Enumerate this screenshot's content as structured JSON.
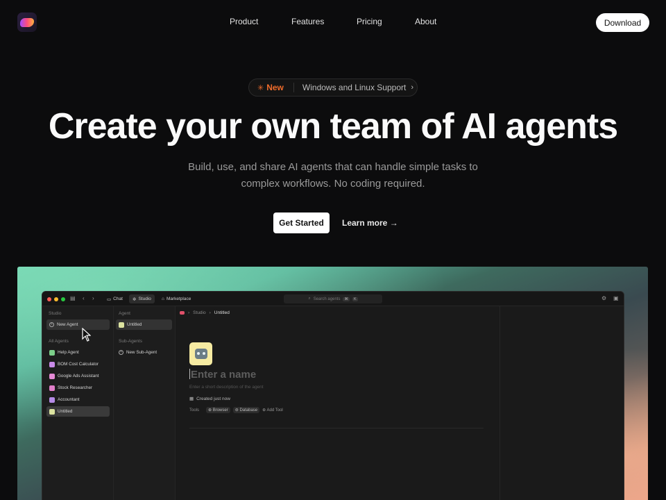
{
  "nav": {
    "links": [
      "Product",
      "Features",
      "Pricing",
      "About"
    ],
    "download_label": "Download"
  },
  "announcement": {
    "badge": "New",
    "text": "Windows and Linux Support"
  },
  "hero": {
    "title": "Create your own team of AI agents",
    "subtitle_line1": "Build, use, and share AI agents that can handle simple tasks to",
    "subtitle_line2": "complex workflows. No coding required.",
    "primary_cta": "Get Started",
    "secondary_cta": "Learn more →"
  },
  "app": {
    "tabs": [
      "Chat",
      "Studio",
      "Marketplace"
    ],
    "active_tab": "Studio",
    "search_placeholder": "Search agents",
    "search_shortcut": [
      "⌘",
      "K"
    ],
    "sidebar": {
      "section_title": "Studio",
      "new_agent_label": "New Agent",
      "all_agents_title": "All Agents",
      "agents": [
        {
          "label": "Help Agent",
          "color": "#7ccf8a"
        },
        {
          "label": "BOM Cost Calculator",
          "color": "#c98be8"
        },
        {
          "label": "Google Ads Assistant",
          "color": "#e58bd6"
        },
        {
          "label": "Stock Researcher",
          "color": "#e07ec9"
        },
        {
          "label": "Accountant",
          "color": "#b58be6"
        },
        {
          "label": "Untitled",
          "color": "#dce3a0"
        }
      ]
    },
    "agent_column": {
      "agent_title": "Agent",
      "agent_item": "Untitled",
      "subagents_title": "Sub-Agents",
      "new_subagent_label": "New Sub-Agent"
    },
    "breadcrumb": [
      "Studio",
      "Untitled"
    ],
    "editor": {
      "name_placeholder": "Enter a name",
      "description_placeholder": "Enter a short description of the agent",
      "created_text": "Created just now",
      "tools_label": "Tools",
      "tools": [
        "Browser",
        "Database"
      ],
      "add_tool_label": "Add Tool"
    }
  }
}
